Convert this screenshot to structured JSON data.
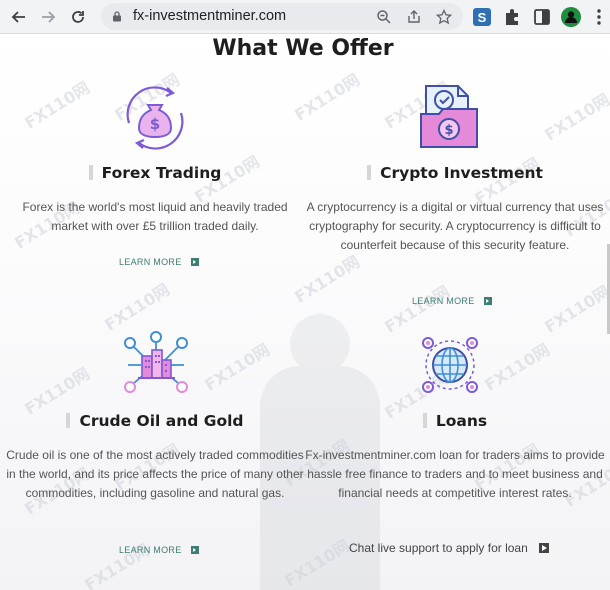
{
  "browser": {
    "url": "fx-investmentminer.com",
    "icons": [
      "back-icon",
      "forward-icon",
      "reload-icon",
      "lock-icon",
      "zoom-icon",
      "share-icon",
      "bookmark-star-icon",
      "extension-s-icon",
      "extensions-puzzle-icon",
      "side-panel-icon",
      "profile-icon",
      "menu-icon"
    ]
  },
  "section": {
    "title": "What We Offer"
  },
  "watermark": "FX110网",
  "services": [
    {
      "title": "Forex Trading",
      "description": "Forex is the world's most liquid and heavily traded market with over £5 trillion traded daily.",
      "link": "LEARN MORE",
      "icon": "money-bag-cycle-icon"
    },
    {
      "title": "Crypto Investment",
      "description": "A cryptocurrency is a digital or virtual currency that uses cryptography for security. A cryptocurrency is difficult to counterfeit because of this security feature.",
      "link": "LEARN MORE",
      "icon": "crypto-folder-coin-icon"
    },
    {
      "title": "Crude Oil and Gold",
      "description": "Crude oil is one of the most actively traded commodities in the world, and its price affects the price of many other commodities, including gasoline and natural gas.",
      "link": "LEARN MORE",
      "icon": "building-network-icon"
    },
    {
      "title": "Loans",
      "description": "Fx-investmentminer.com loan for traders aims to provide hassle free finance to traders and to meet business and financial needs at competitive interest rates.",
      "link": "Chat live support to apply for loan",
      "icon": "globe-network-icon"
    }
  ],
  "colors": {
    "accent_teal": "#3e7d73",
    "icon_purple": "#7b5bd6",
    "icon_pink": "#e48ad8",
    "icon_blue": "#3f8fd6"
  }
}
